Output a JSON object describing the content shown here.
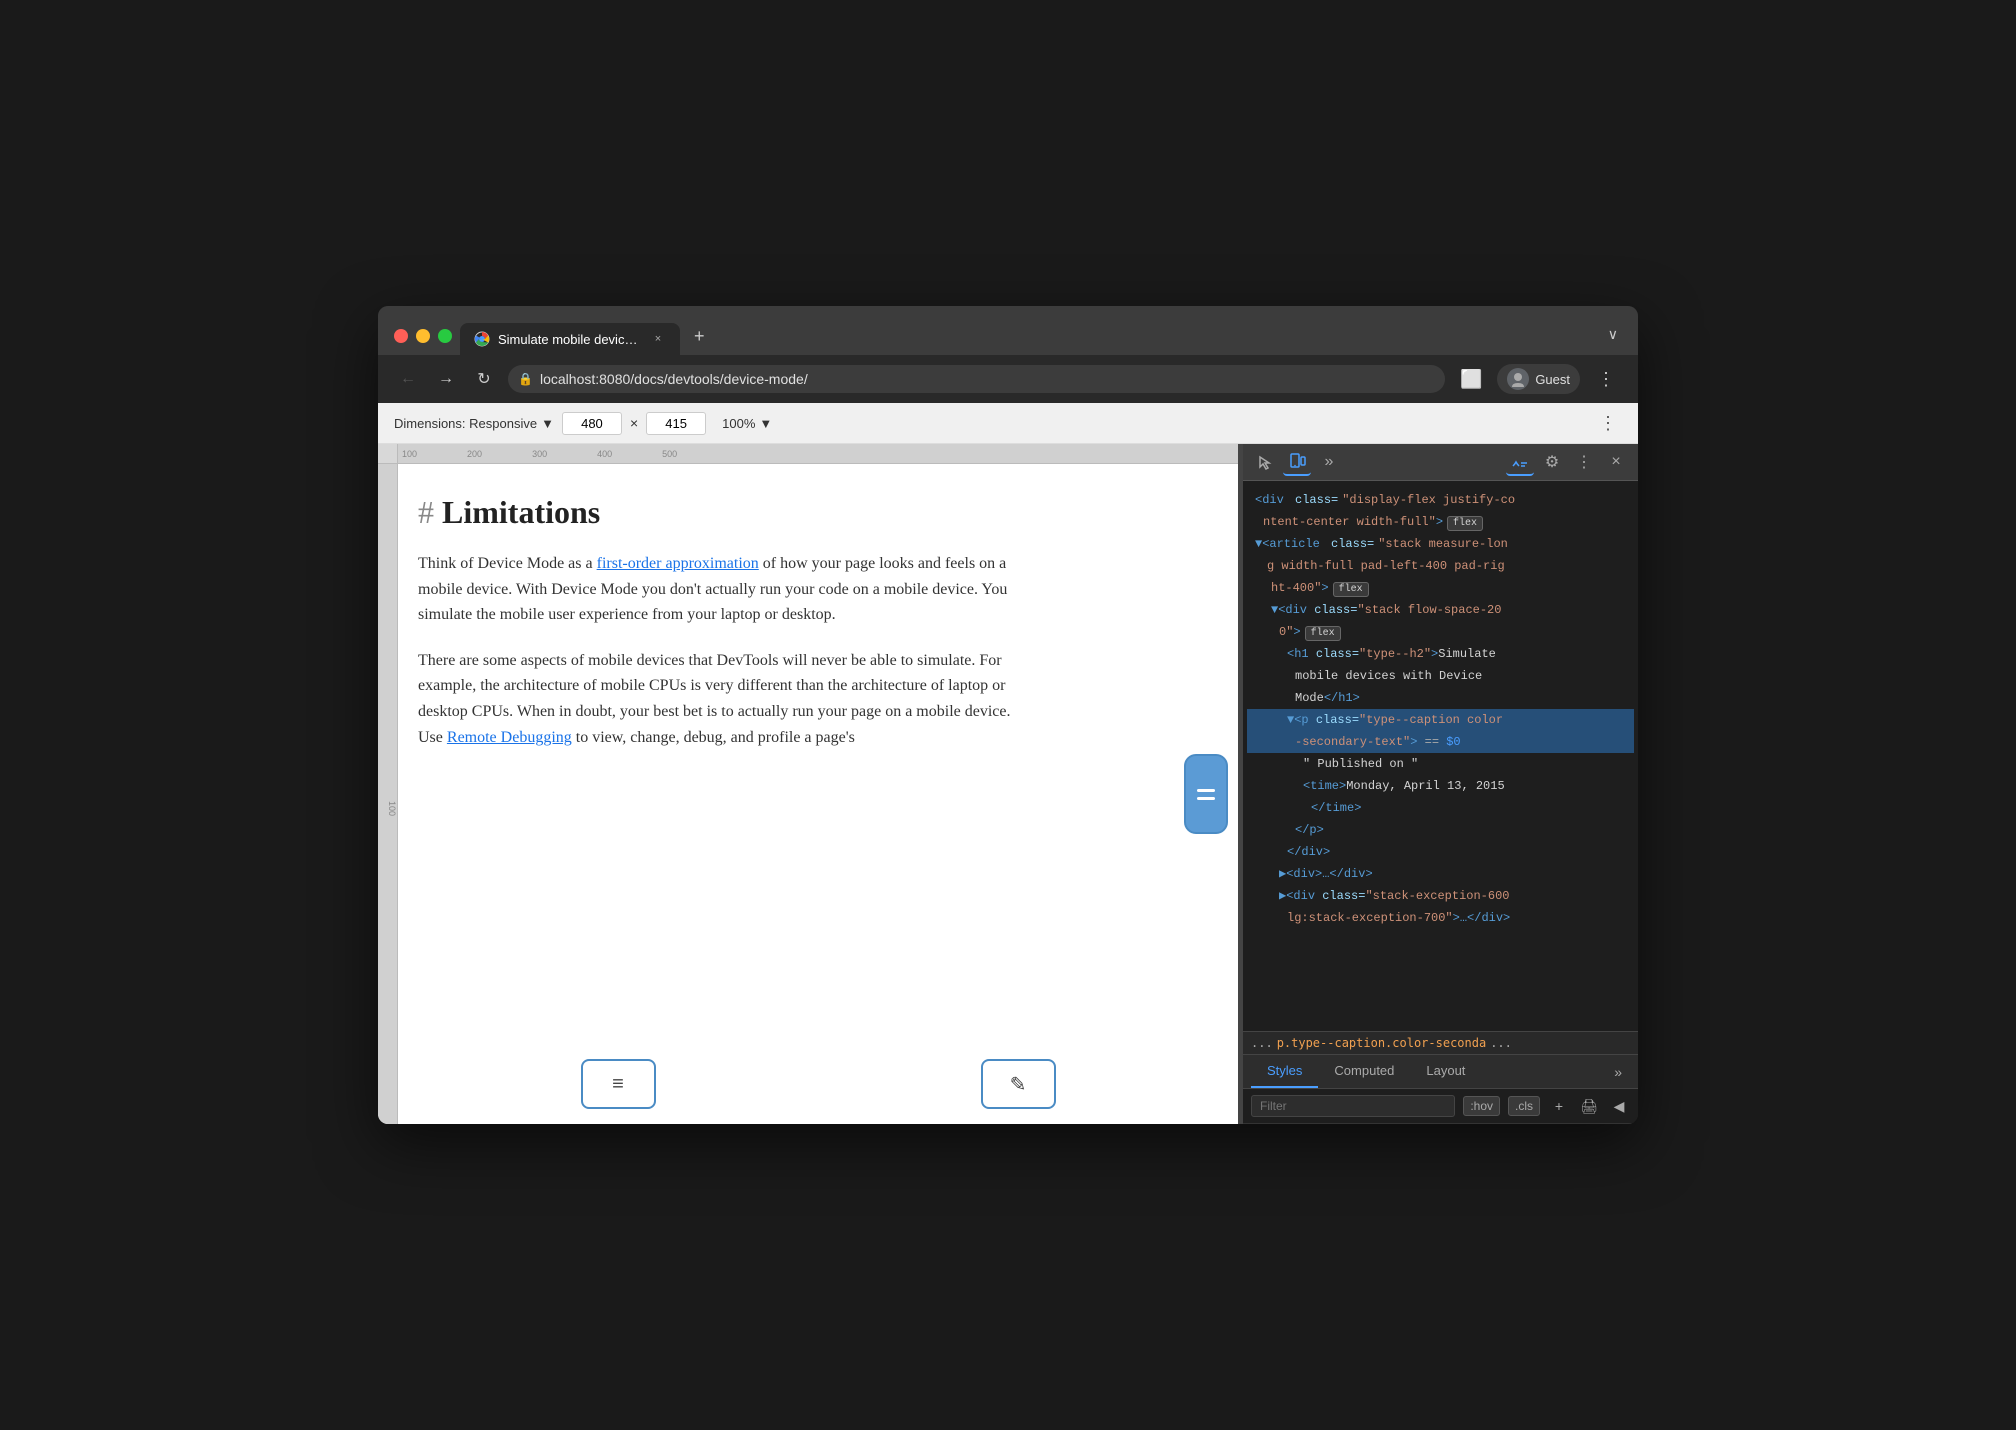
{
  "browser": {
    "tab": {
      "label": "Simulate mobile devices with D",
      "close_label": "×"
    },
    "new_tab_label": "+",
    "chevron": "∨",
    "nav": {
      "back": "←",
      "forward": "→",
      "refresh": "↻",
      "url": "localhost:8080/docs/devtools/device-mode/",
      "lock_icon": "🔒"
    },
    "address_bar_right": {
      "tab_icon": "⬜",
      "profile_label": "Guest",
      "more_icon": "⋮"
    }
  },
  "device_toolbar": {
    "dimensions_label": "Dimensions: Responsive",
    "width": "480",
    "height": "415",
    "x_separator": "×",
    "zoom": "100%",
    "more_icon": "⋮"
  },
  "page": {
    "heading_hash": "#",
    "heading": "Limitations",
    "paragraph1": "Think of Device Mode as a ",
    "link1": "first-order approximation",
    "paragraph1_cont": " of how your page looks and feels on a mobile device. With Device Mode you don't actually run your code on a mobile device. You simulate the mobile user experience from your laptop or desktop.",
    "paragraph2": "There are some aspects of mobile devices that DevTools will never be able to simulate. For example, the architecture of mobile CPUs is very different than the architecture of laptop or desktop CPUs. When in doubt, your best bet is to actually run your page on a mobile device. Use ",
    "link2": "Remote Debugging",
    "paragraph2_cont": " to view, change, debug, and profile a page's"
  },
  "devtools": {
    "icons": {
      "cursor": "⬚",
      "device": "📱",
      "more": "»",
      "chat": "💬",
      "settings": "⚙",
      "more_vert": "⋮",
      "close": "×"
    },
    "html": {
      "lines": [
        {
          "indent": 0,
          "content": "<div class=\"display-flex justify-co",
          "badge": null,
          "highlight": false
        },
        {
          "indent": 1,
          "content": "ntent-center width-full\">",
          "badge": "flex",
          "highlight": false
        },
        {
          "indent": 0,
          "content": "▼<article class=\"stack measure-lon",
          "badge": null,
          "highlight": false
        },
        {
          "indent": 1,
          "content": "g width-full pad-left-400 pad-rig",
          "badge": null,
          "highlight": false
        },
        {
          "indent": 2,
          "content": "ht-400\">",
          "badge": "flex",
          "highlight": false
        },
        {
          "indent": 2,
          "content": "▼<div class=\"stack flow-space-20",
          "badge": null,
          "highlight": false
        },
        {
          "indent": 3,
          "content": "0\">",
          "badge": "flex",
          "highlight": false
        },
        {
          "indent": 4,
          "content": "<h1 class=\"type--h2\">Simulate",
          "badge": null,
          "highlight": false
        },
        {
          "indent": 5,
          "content": "mobile devices with Device",
          "badge": null,
          "highlight": false
        },
        {
          "indent": 5,
          "content": "Mode</h1>",
          "badge": null,
          "highlight": false
        },
        {
          "indent": 4,
          "content": "▼<p class=\"type--caption color",
          "badge": null,
          "highlight": true
        },
        {
          "indent": 5,
          "content": "-secondary-text\"> == $0",
          "badge": null,
          "highlight": true
        },
        {
          "indent": 6,
          "content": "\" Published on \"",
          "badge": null,
          "highlight": false
        },
        {
          "indent": 6,
          "content": "<time>Monday, April 13, 2015",
          "badge": null,
          "highlight": false
        },
        {
          "indent": 7,
          "content": "</time>",
          "badge": null,
          "highlight": false
        },
        {
          "indent": 6,
          "content": "</p>",
          "badge": null,
          "highlight": false
        },
        {
          "indent": 5,
          "content": "</div>",
          "badge": null,
          "highlight": false
        },
        {
          "indent": 4,
          "content": "▶<div>…</div>",
          "badge": null,
          "highlight": false
        },
        {
          "indent": 4,
          "content": "▶<div class=\"stack-exception-600",
          "badge": null,
          "highlight": false
        },
        {
          "indent": 5,
          "content": "lg:stack-exception-700\">…</div>",
          "badge": null,
          "highlight": false
        }
      ]
    },
    "breadcrumb": "... p.type--caption.color-seconda ...",
    "styles_tabs": [
      "Styles",
      "Computed",
      "Layout"
    ],
    "filter_placeholder": "Filter",
    "filter_pills": [
      ":hov",
      ".cls"
    ],
    "filter_icons": [
      "+",
      "🖨",
      "◀"
    ]
  }
}
